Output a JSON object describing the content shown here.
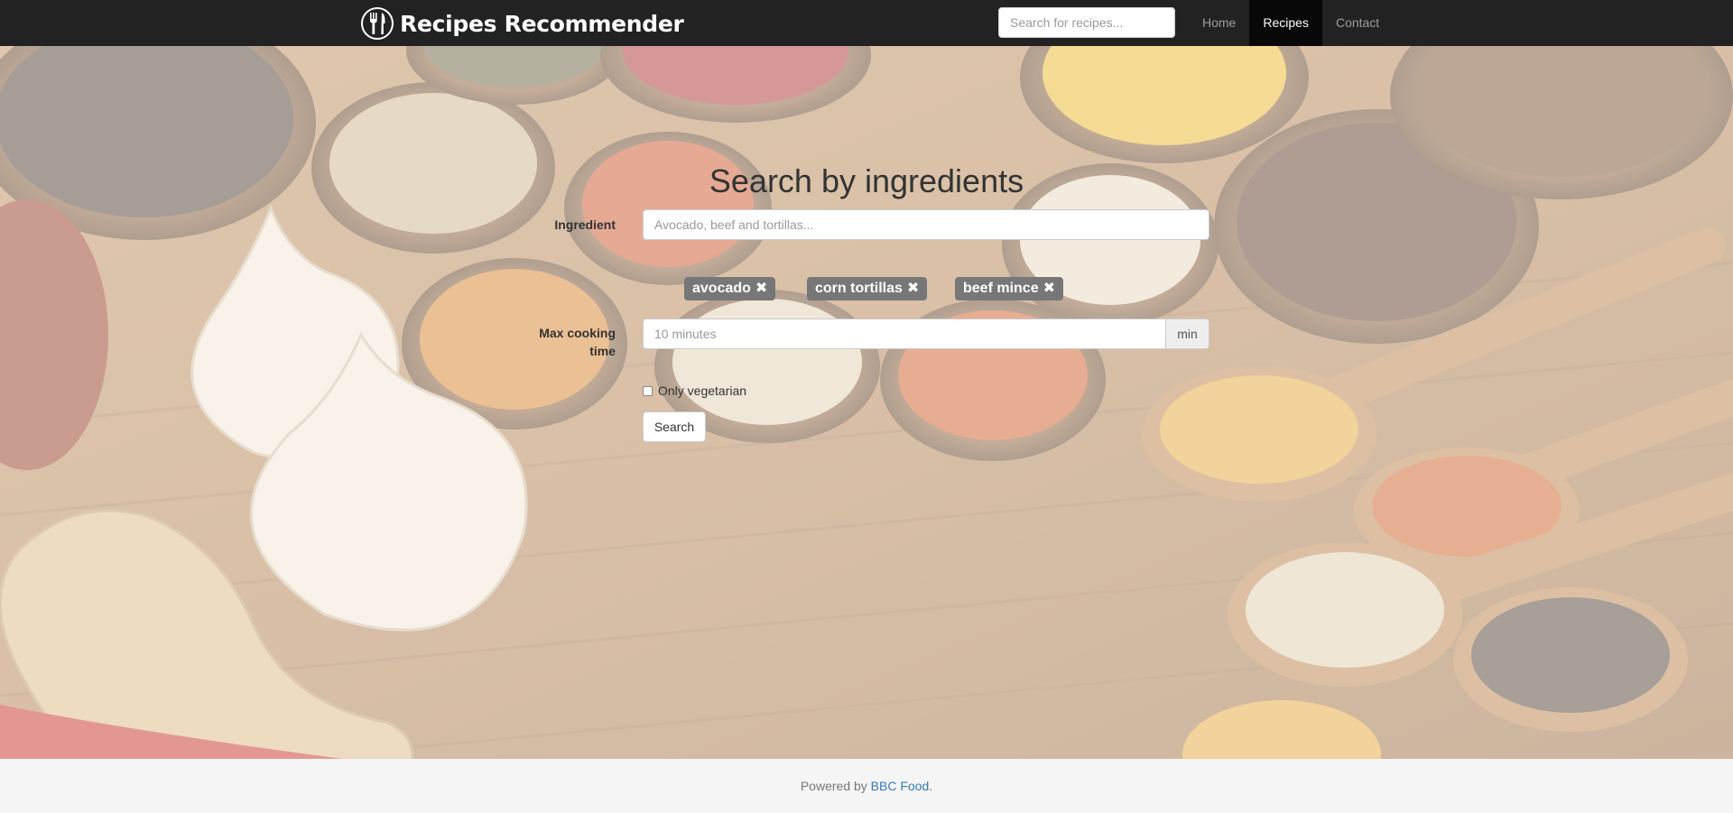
{
  "navbar": {
    "brand": "Recipes Recommender",
    "brand_icon": "fork-knife-icon",
    "search_placeholder": "Search for recipes...",
    "links": [
      {
        "label": "Home",
        "active": false
      },
      {
        "label": "Recipes",
        "active": true
      },
      {
        "label": "Contact",
        "active": false
      }
    ]
  },
  "form": {
    "title": "Search by ingredients",
    "ingredient_label": "Ingredient",
    "ingredient_placeholder": "Avocado, beef and tortillas...",
    "tags": [
      {
        "label": "avocado",
        "remove_icon": "close-icon"
      },
      {
        "label": "corn tortillas",
        "remove_icon": "close-icon"
      },
      {
        "label": "beef mince",
        "remove_icon": "close-icon"
      }
    ],
    "max_time_label_line1": "Max cooking",
    "max_time_label_line2": "time",
    "max_time_placeholder": "10 minutes",
    "max_time_unit": "min",
    "vegetarian_label": "Only vegetarian",
    "vegetarian_checked": false,
    "search_button": "Search"
  },
  "footer": {
    "prefix": "Powered by ",
    "link": "BBC Food",
    "suffix": "."
  },
  "colors": {
    "navbar": "#222222",
    "nav_active": "#080808",
    "tag": "#777777",
    "link": "#337ab7"
  }
}
